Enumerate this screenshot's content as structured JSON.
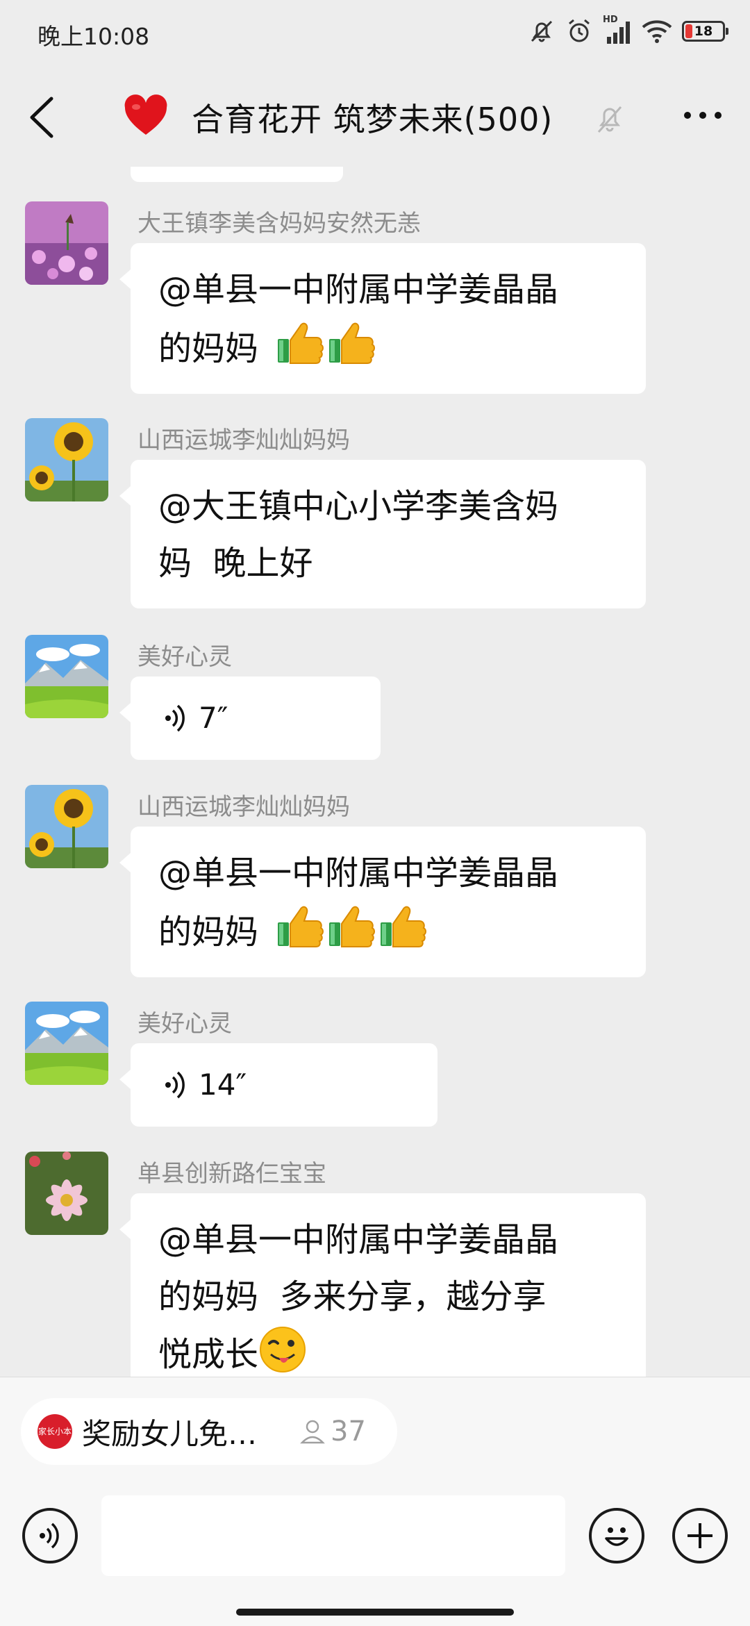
{
  "status_bar": {
    "time": "晚上10:08",
    "network_label": "HD",
    "battery_level": "18",
    "battery_color": "#e53935"
  },
  "header": {
    "title": "合育花开 筑梦未来(500)",
    "heart_color": "#e0141c",
    "icons": [
      "back-icon",
      "heart-icon",
      "mute-bell-icon",
      "more-icon"
    ]
  },
  "messages": [
    {
      "sender": "大王镇李美含妈妈安然无恙",
      "type": "text",
      "lines": [
        "@单县一中附属中学姜晶晶",
        "的妈妈"
      ],
      "emoji": "thumbs-up",
      "emoji_count": 2
    },
    {
      "sender": "山西运城李灿灿妈妈",
      "type": "text",
      "lines": [
        "@大王镇中心小学李美含妈",
        "妈  晚上好"
      ]
    },
    {
      "sender": "美好心灵",
      "type": "voice",
      "duration": "7″"
    },
    {
      "sender": "山西运城李灿灿妈妈",
      "type": "text",
      "lines": [
        "@单县一中附属中学姜晶晶",
        "的妈妈"
      ],
      "emoji": "thumbs-up",
      "emoji_count": 3
    },
    {
      "sender": "美好心灵",
      "type": "voice",
      "duration": "14″"
    },
    {
      "sender": "单县创新路仨宝宝",
      "type": "text",
      "lines": [
        "@单县一中附属中学姜晶晶",
        "的妈妈  多来分享，越分享",
        "悦成长"
      ],
      "emoji": "winking-tongue-face",
      "emoji_count": 1
    }
  ],
  "notice": {
    "logo_text": "家长小本",
    "text": "奖励女儿免…",
    "count": "37"
  },
  "input": {
    "placeholder": ""
  }
}
